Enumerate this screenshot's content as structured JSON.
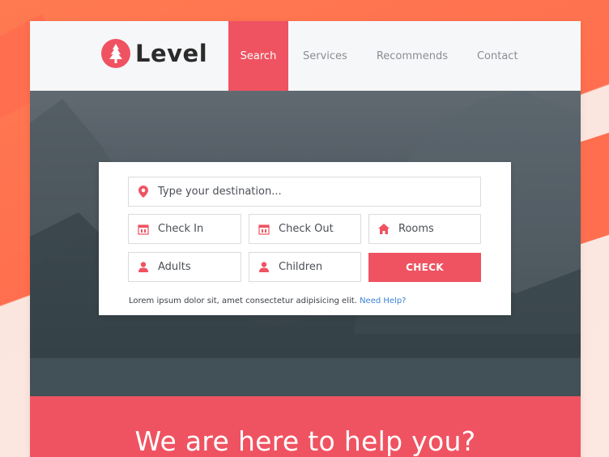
{
  "brand": {
    "name": "Level",
    "color": "#ef5361"
  },
  "nav": {
    "items": [
      {
        "label": "Search",
        "active": true
      },
      {
        "label": "Services",
        "active": false
      },
      {
        "label": "Recommends",
        "active": false
      },
      {
        "label": "Contact",
        "active": false
      }
    ]
  },
  "search": {
    "destination_placeholder": "Type your destination...",
    "check_in_placeholder": "Check In",
    "check_out_placeholder": "Check Out",
    "rooms_placeholder": "Rooms",
    "adults_placeholder": "Adults",
    "children_placeholder": "Children",
    "check_button": "CHECK",
    "note_text": "Lorem ipsum dolor sit, amet consectetur adipisicing elit.",
    "help_link": "Need Help?"
  },
  "banner": {
    "title": "We are here to help you?"
  },
  "icons": {
    "logo": "tree-icon",
    "destination": "map-pin-icon",
    "check_in": "calendar-icon",
    "check_out": "calendar-icon",
    "rooms": "home-icon",
    "adults": "user-icon",
    "children": "user-icon"
  }
}
